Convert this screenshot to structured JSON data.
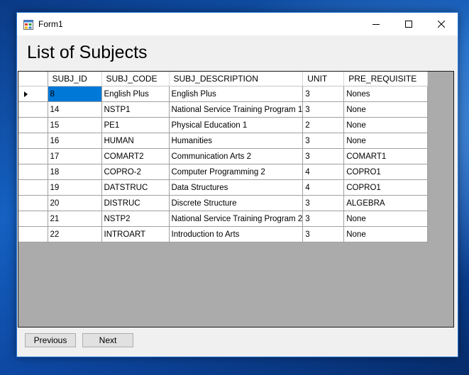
{
  "window": {
    "title": "Form1"
  },
  "heading": "List of Subjects",
  "grid": {
    "columns": [
      "SUBJ_ID",
      "SUBJ_CODE",
      "SUBJ_DESCRIPTION",
      "UNIT",
      "PRE_REQUISITE"
    ],
    "rows": [
      [
        "8",
        "English Plus",
        "English Plus",
        "3",
        "Nones"
      ],
      [
        "14",
        "NSTP1",
        "National Service Training Program 1",
        "3",
        "None"
      ],
      [
        "15",
        "PE1",
        "Physical Education 1",
        "2",
        "None"
      ],
      [
        "16",
        "HUMAN",
        "Humanities",
        "3",
        "None"
      ],
      [
        "17",
        "COMART2",
        "Communication Arts 2",
        "3",
        "COMART1"
      ],
      [
        "18",
        "COPRO-2",
        "Computer Programming 2",
        "4",
        "COPRO1"
      ],
      [
        "19",
        "DATSTRUC",
        "Data Structures",
        "4",
        "COPRO1"
      ],
      [
        "20",
        "DISTRUC",
        "Discrete Structure",
        "3",
        "ALGEBRA"
      ],
      [
        "21",
        "NSTP2",
        "National Service Training Program 2",
        "3",
        "None"
      ],
      [
        "22",
        "INTROART",
        "Introduction to Arts",
        "3",
        "None"
      ]
    ],
    "selected_cell": {
      "row": 0,
      "col": 0
    }
  },
  "buttons": {
    "previous": "Previous",
    "next": "Next"
  },
  "colors": {
    "selection": "#0078d7",
    "grid_background": "#ababab",
    "accent_border": "#2b79d8"
  },
  "icons": [
    "winforms-app-icon",
    "minimize-icon",
    "maximize-icon",
    "close-icon",
    "current-row-arrow-icon"
  ]
}
